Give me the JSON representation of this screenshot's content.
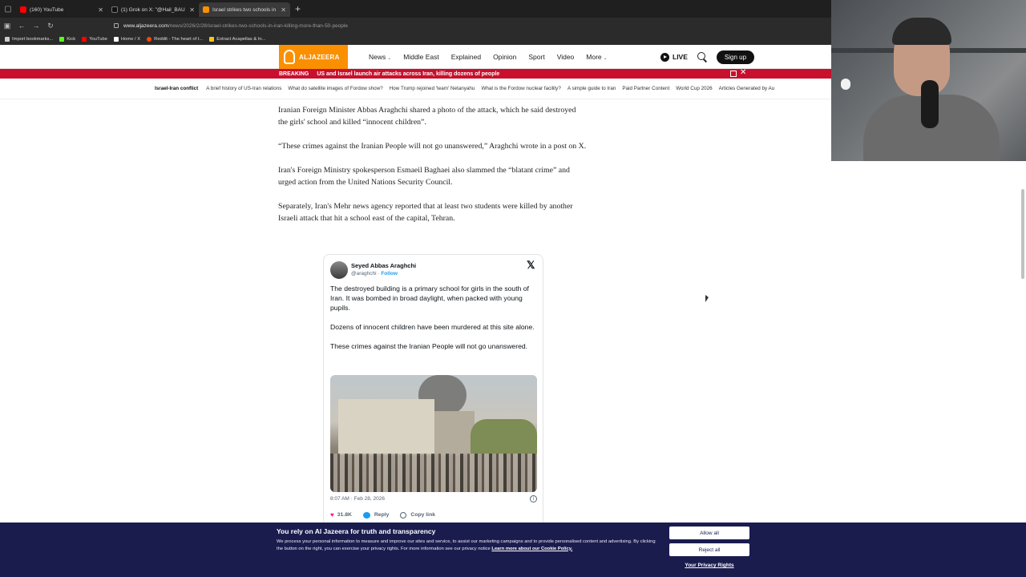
{
  "browser": {
    "tabs": [
      {
        "title": "(160) YouTube",
        "favicon_color": "#ff0000",
        "active": false
      },
      {
        "title": "(1) Grok on X: \"@Hail_BAU @Lu",
        "favicon_color": "#111111",
        "active": false
      },
      {
        "title": "Israel strikes two schools in Iran",
        "favicon_color": "#fa9000",
        "active": true
      }
    ],
    "new_tab": "+",
    "url_host": "www.aljazeera.com",
    "url_path": "/news/2026/2/28/israel-strikes-two-schools-in-iran-killing-more-than-50-people",
    "bookmarks": [
      {
        "label": "Import bookmarks...",
        "color": "#cccccc"
      },
      {
        "label": "Kick",
        "color": "#53fc18"
      },
      {
        "label": "YouTube",
        "color": "#ff0000"
      },
      {
        "label": "Home / X",
        "color": "#ffffff"
      },
      {
        "label": "Reddit - The heart of t...",
        "color": "#ff4500"
      },
      {
        "label": "Extract Acapellas & In...",
        "color": "#f5c518"
      }
    ]
  },
  "site": {
    "logo_text": "ALJAZEERA",
    "brand_color": "#fa9000",
    "nav": [
      "News",
      "Middle East",
      "Explained",
      "Opinion",
      "Sport",
      "Video",
      "More"
    ],
    "live_label": "LIVE",
    "signup_label": "Sign up"
  },
  "breaking": {
    "label": "BREAKING",
    "headline": "US and Israel launch air attacks across Iran, killing dozens of people",
    "color": "#c8102e"
  },
  "topics": {
    "label": "Israel-Iran conflict",
    "items": [
      "A brief history of US-Iran relations",
      "What do satellite images of Fordow show?",
      "How Trump rejoined 'team' Netanyahu",
      "What is the Fordow nuclear facility?",
      "A simple guide to Iran",
      "Paid Partner Content",
      "World Cup 2026",
      "Articles Generated by Au"
    ]
  },
  "article": {
    "paragraphs": [
      "Iranian Foreign Minister Abbas Araghchi shared a photo of the attack, which he said destroyed the girls' school and killed “innocent children”.",
      "“These crimes against the Iranian People will not go unanswered,” Araghchi wrote in a post on X.",
      "Iran's Foreign Ministry spokesperson Esmaeil Baghaei also slammed the “blatant crime” and urged action from the United Nations Security Council.",
      "Separately, Iran's Mehr news agency reported that at least two students were killed by another Israeli attack that hit a school east of the capital, Tehran."
    ]
  },
  "tweet": {
    "name": "Seyed Abbas Araghchi",
    "handle": "@araghchi",
    "follow": "Follow",
    "paragraphs": [
      "The destroyed building is a primary school for girls in the south of Iran. It was bombed in broad daylight, when packed with young pupils.",
      "Dozens of innocent children have been murdered at this site alone.",
      "These crimes against the Iranian People will not go unanswered."
    ],
    "timestamp": "8:07 AM · Feb 28, 2026",
    "likes": "31.8K",
    "reply_label": "Reply",
    "copy_link_label": "Copy link"
  },
  "consent": {
    "title": "You rely on Al Jazeera for truth and transparency",
    "text": "We process your personal information to measure and improve our sites and service, to assist our marketing campaigns and to provide personalised content and advertising. By clicking the button on the right, you can exercise your privacy rights. For more information see our privacy notice",
    "link": "Learn more about our Cookie Policy.",
    "allow_label": "Allow all",
    "reject_label": "Reject all",
    "privacy_label": "Your Privacy Rights",
    "bg_color": "#1b1c4e"
  }
}
